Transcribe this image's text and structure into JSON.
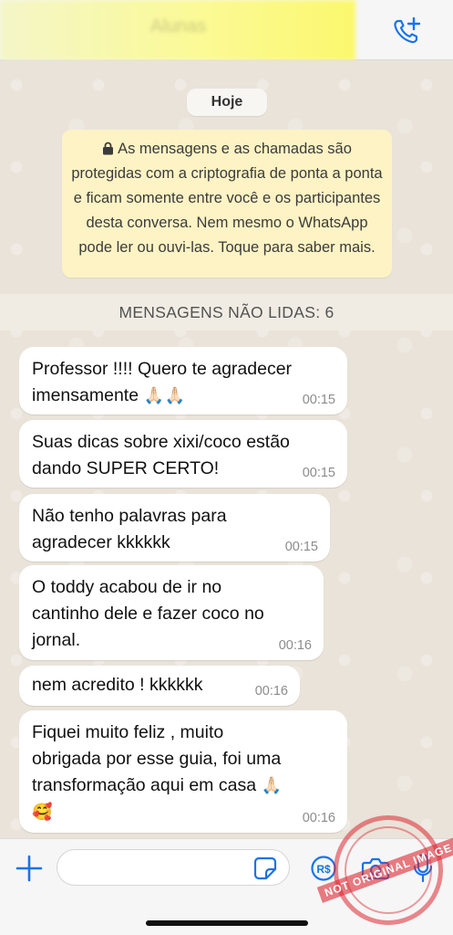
{
  "header": {
    "contact_name": "Alunas",
    "call_icon": "phone-add-icon"
  },
  "chat": {
    "date_label": "Hoje",
    "encryption_notice": "As mensagens e as chamadas são protegidas com a criptografia de ponta a ponta e ficam somente entre você e os participantes desta conversa. Nem mesmo o WhatsApp pode ler ou ouvi-las. Toque para saber mais.",
    "unread_label": "MENSAGENS NÃO LIDAS: 6",
    "messages": [
      {
        "text": "Professor !!!! Quero te agradecer\nimensamente",
        "emoji": "🙏🏻🙏🏻",
        "time": "00:15"
      },
      {
        "text": "Suas dicas sobre xixi/coco estão\ndando SUPER CERTO!",
        "emoji": "",
        "time": "00:15"
      },
      {
        "text": "Não tenho palavras para\nagradecer kkkkkk",
        "emoji": "",
        "time": "00:15"
      },
      {
        "text": "O toddy acabou de ir no\ncantinho dele e fazer coco no\njornal.",
        "emoji": "",
        "time": "00:16"
      },
      {
        "text": "nem acredito ! kkkkkk",
        "emoji": "",
        "time": "00:16"
      },
      {
        "text": "Fiquei muito feliz , muito\nobrigada por esse guia, foi uma\ntransformação aqui em casa",
        "emoji": "🙏🏻",
        "emoji2": "🥰",
        "time": "00:16"
      }
    ]
  },
  "input_bar": {
    "placeholder": "",
    "icons": [
      "plus-icon",
      "sticker-icon",
      "payment-icon",
      "camera-icon",
      "microphone-icon"
    ]
  },
  "watermark": {
    "text": "NOT ORIGINAL IMAGE"
  },
  "colors": {
    "accent": "#1a73e8",
    "notice_bg": "#fdf3c4",
    "chat_bg": "#e9e3d9",
    "stamp": "#dc2832"
  }
}
